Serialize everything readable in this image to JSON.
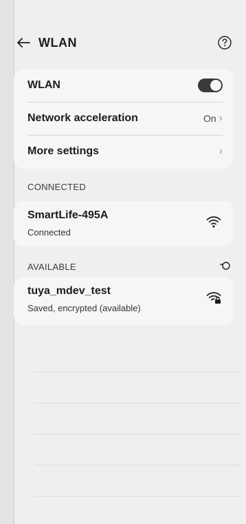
{
  "header": {
    "title": "WLAN"
  },
  "settings": {
    "wlan_label": "WLAN",
    "wlan_enabled": true,
    "acceleration_label": "Network acceleration",
    "acceleration_value": "On",
    "more_settings_label": "More settings"
  },
  "sections": {
    "connected_title": "CONNECTED",
    "available_title": "AVAILABLE"
  },
  "connected": [
    {
      "name": "SmartLife-495A",
      "status": "Connected",
      "icon": "wifi-icon"
    }
  ],
  "available": [
    {
      "name": "tuya_mdev_test",
      "status": "Saved, encrypted (available)",
      "icon": "wifi-locked-icon"
    }
  ],
  "icons": {
    "back": "arrow-left-icon",
    "help": "help-circle-icon",
    "scan": "refresh-icon",
    "chevron": "chevron-right-icon"
  },
  "colors": {
    "background": "#efefef",
    "card": "#f6f6f6",
    "toggle_on": "#3a3a3a"
  }
}
